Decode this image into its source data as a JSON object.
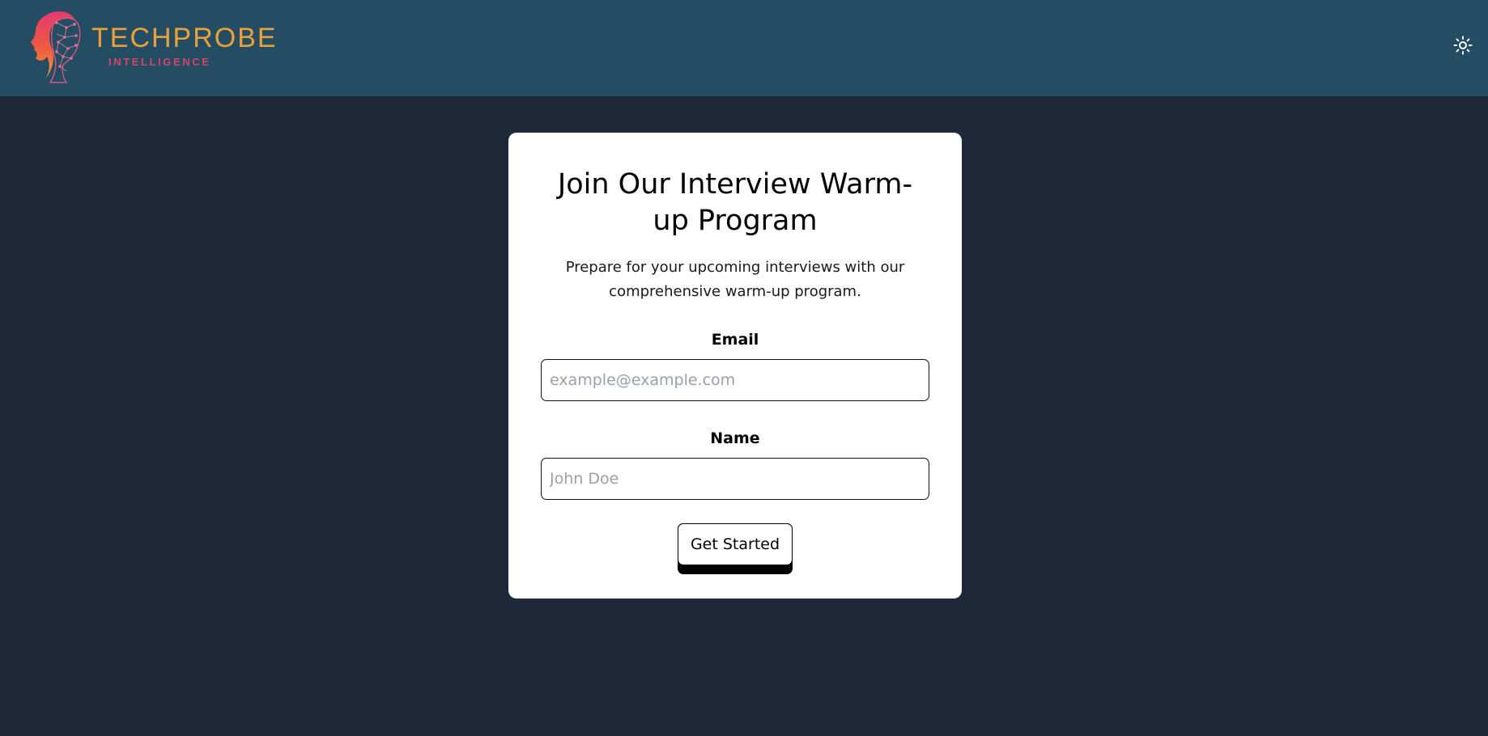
{
  "header": {
    "brand_name": "TECHPROBE",
    "brand_tagline": "INTELLIGENCE",
    "theme_toggle_icon": "sun-icon"
  },
  "form": {
    "title": "Join Our Interview Warm-up Program",
    "description": "Prepare for your upcoming interviews with our comprehensive warm-up program.",
    "email_label": "Email",
    "email_placeholder": "example@example.com",
    "email_value": "",
    "name_label": "Name",
    "name_placeholder": "John Doe",
    "name_value": "",
    "submit_label": "Get Started"
  },
  "colors": {
    "header_bg": "#244d63",
    "page_bg": "#1f2839",
    "brand_gold": "#e8a13c",
    "brand_pink": "#d54467"
  }
}
